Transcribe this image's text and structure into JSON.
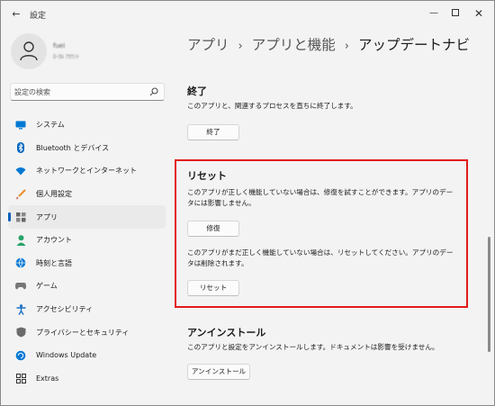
{
  "window": {
    "title": "設定",
    "controls": {
      "minimize": "—",
      "close": "✕"
    }
  },
  "user": {
    "name": "fuei",
    "email": "ﾛｰｶﾙ ｱｶｳﾝﾄ"
  },
  "search": {
    "placeholder": "設定の検索"
  },
  "sidebar": {
    "items": [
      {
        "label": "システム",
        "icon": "monitor-icon",
        "color": "#0078d4"
      },
      {
        "label": "Bluetooth とデバイス",
        "icon": "bluetooth-icon",
        "color": "#0067c0"
      },
      {
        "label": "ネットワークとインターネット",
        "icon": "wifi-icon",
        "color": "#0078d4"
      },
      {
        "label": "個人用設定",
        "icon": "brush-icon",
        "color": "#e8912d"
      },
      {
        "label": "アプリ",
        "icon": "apps-icon",
        "color": "#555555",
        "active": true
      },
      {
        "label": "アカウント",
        "icon": "person-icon",
        "color": "#2aa36a"
      },
      {
        "label": "時刻と言語",
        "icon": "globe-clock-icon",
        "color": "#0078d4"
      },
      {
        "label": "ゲーム",
        "icon": "gamepad-icon",
        "color": "#777777"
      },
      {
        "label": "アクセシビリティ",
        "icon": "accessibility-icon",
        "color": "#1a6fc4"
      },
      {
        "label": "プライバシーとセキュリティ",
        "icon": "shield-icon",
        "color": "#6b6b6b"
      },
      {
        "label": "Windows Update",
        "icon": "update-icon",
        "color": "#0078d4"
      },
      {
        "label": "Extras",
        "icon": "extras-icon",
        "color": "#333333"
      }
    ]
  },
  "breadcrumb": {
    "items": [
      "アプリ",
      "アプリと機能"
    ],
    "separator": "›",
    "current": "アップデートナビ"
  },
  "sections": {
    "terminate": {
      "heading": "終了",
      "description": "このアプリと、関連するプロセスを直ちに終了します。",
      "button": "終了"
    },
    "reset": {
      "heading": "リセット",
      "repair_description": "このアプリが正しく機能していない場合は、修復を試すことができます。アプリのデータには影響しません。",
      "repair_button": "修復",
      "reset_description": "このアプリがまだ正しく機能していない場合は、リセットしてください。アプリのデータは削除されます。",
      "reset_button": "リセット"
    },
    "uninstall": {
      "heading": "アンインストール",
      "description": "このアプリと設定をアンインストールします。ドキュメントは影響を受けません。",
      "button": "アンインストール"
    }
  },
  "colors": {
    "accent": "#005fb8",
    "highlight_border": "#e31a1a"
  }
}
